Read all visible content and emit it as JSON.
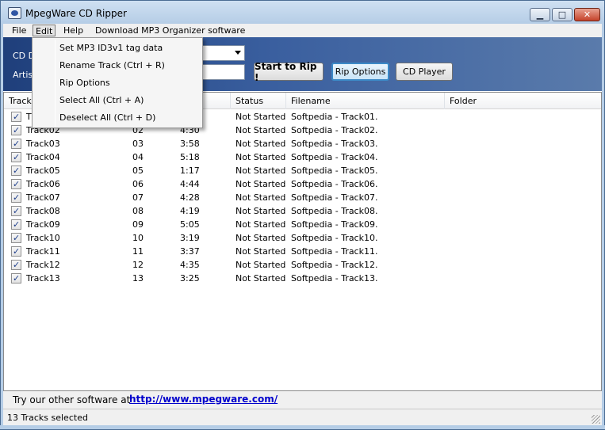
{
  "window": {
    "title": "MpegWare CD Ripper",
    "minimize_glyph": "▁",
    "maximize_glyph": "□",
    "close_glyph": "✕"
  },
  "menubar": {
    "file": "File",
    "edit": "Edit",
    "help": "Help",
    "download": "Download MP3 Organizer software"
  },
  "edit_menu": {
    "items": [
      "Set MP3 ID3v1 tag data",
      "Rename Track (Ctrl + R)",
      "Rip Options",
      "Select All (Ctrl + A)",
      "Deselect All (Ctrl + D)"
    ]
  },
  "toolbar": {
    "cd_label": "CD D",
    "artist_label": "Artis",
    "start_button": "Start to Rip !",
    "rip_options_button": "Rip Options",
    "cd_player_button": "CD Player"
  },
  "list": {
    "headers": {
      "track": "Track",
      "time": "ime",
      "status": "Status",
      "filename": "Filename",
      "folder": "Folder"
    },
    "rows": [
      {
        "name": "T",
        "num": "",
        "time": "",
        "status": "Not Started",
        "filename": "Softpedia - Track01."
      },
      {
        "name": "Track02",
        "num": "02",
        "time": "4:30",
        "status": "Not Started",
        "filename": "Softpedia - Track02."
      },
      {
        "name": "Track03",
        "num": "03",
        "time": "3:58",
        "status": "Not Started",
        "filename": "Softpedia - Track03."
      },
      {
        "name": "Track04",
        "num": "04",
        "time": "5:18",
        "status": "Not Started",
        "filename": "Softpedia - Track04."
      },
      {
        "name": "Track05",
        "num": "05",
        "time": "1:17",
        "status": "Not Started",
        "filename": "Softpedia - Track05."
      },
      {
        "name": "Track06",
        "num": "06",
        "time": "4:44",
        "status": "Not Started",
        "filename": "Softpedia - Track06."
      },
      {
        "name": "Track07",
        "num": "07",
        "time": "4:28",
        "status": "Not Started",
        "filename": "Softpedia - Track07."
      },
      {
        "name": "Track08",
        "num": "08",
        "time": "4:19",
        "status": "Not Started",
        "filename": "Softpedia - Track08."
      },
      {
        "name": "Track09",
        "num": "09",
        "time": "5:05",
        "status": "Not Started",
        "filename": "Softpedia - Track09."
      },
      {
        "name": "Track10",
        "num": "10",
        "time": "3:19",
        "status": "Not Started",
        "filename": "Softpedia - Track10."
      },
      {
        "name": "Track11",
        "num": "11",
        "time": "3:37",
        "status": "Not Started",
        "filename": "Softpedia - Track11."
      },
      {
        "name": "Track12",
        "num": "12",
        "time": "4:35",
        "status": "Not Started",
        "filename": "Softpedia - Track12."
      },
      {
        "name": "Track13",
        "num": "13",
        "time": "3:25",
        "status": "Not Started",
        "filename": "Softpedia - Track13."
      }
    ]
  },
  "footer": {
    "promo_text": "Try our other software at",
    "promo_link": "http://www.mpegware.com/"
  },
  "status": {
    "text": "13 Tracks selected"
  }
}
